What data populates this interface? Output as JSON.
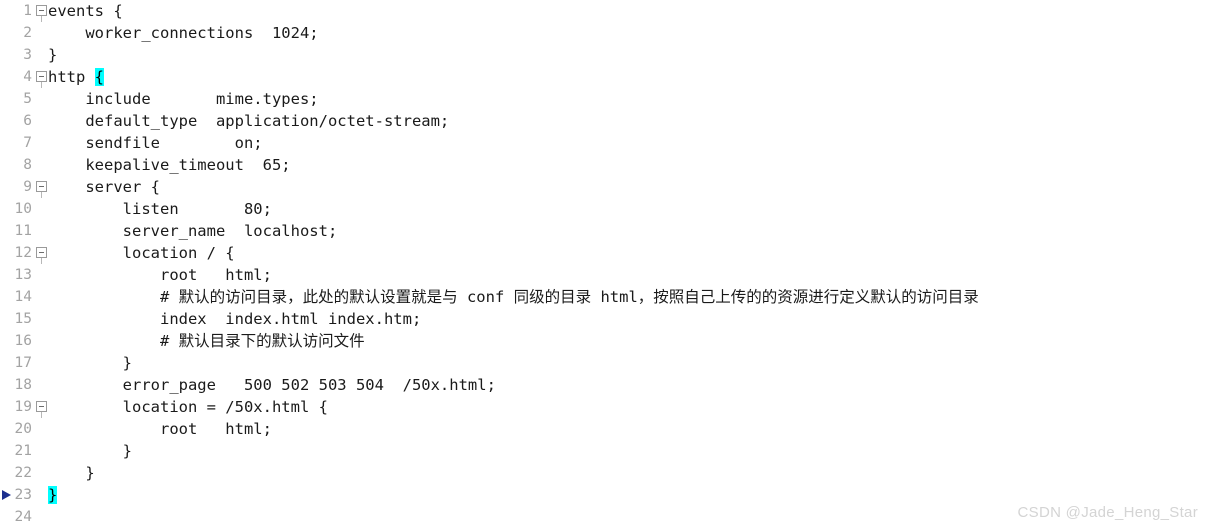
{
  "editor": {
    "language": "nginx-conf",
    "colors": {
      "background": "#ffffff",
      "text": "#1a1a1a",
      "line_number": "#a3a3a3",
      "brace_match_highlight": "#00ffff",
      "fold_marker": "#9a9a9a",
      "exec_marker": "#1b2f8f",
      "watermark": "#d4d4d4"
    },
    "lines": [
      {
        "n": "1",
        "fold": true,
        "marker": false,
        "text": "events {"
      },
      {
        "n": "2",
        "fold": false,
        "marker": false,
        "text": "    worker_connections  1024;"
      },
      {
        "n": "3",
        "fold": false,
        "marker": false,
        "text": "}"
      },
      {
        "n": "4",
        "fold": true,
        "marker": false,
        "pre": "http ",
        "hl": "{",
        "post": ""
      },
      {
        "n": "5",
        "fold": false,
        "marker": false,
        "text": "    include       mime.types;"
      },
      {
        "n": "6",
        "fold": false,
        "marker": false,
        "text": "    default_type  application/octet-stream;"
      },
      {
        "n": "7",
        "fold": false,
        "marker": false,
        "text": "    sendfile        on;"
      },
      {
        "n": "8",
        "fold": false,
        "marker": false,
        "text": "    keepalive_timeout  65;"
      },
      {
        "n": "9",
        "fold": true,
        "marker": false,
        "text": "    server {"
      },
      {
        "n": "10",
        "fold": false,
        "marker": false,
        "text": "        listen       80;"
      },
      {
        "n": "11",
        "fold": false,
        "marker": false,
        "text": "        server_name  localhost;"
      },
      {
        "n": "12",
        "fold": true,
        "marker": false,
        "text": "        location / {"
      },
      {
        "n": "13",
        "fold": false,
        "marker": false,
        "text": "            root   html;"
      },
      {
        "n": "14",
        "fold": false,
        "marker": false,
        "text": "            # 默认的访问目录，此处的默认设置就是与 conf 同级的目录 html，按照自己上传的的资源进行定义默认的访问目录"
      },
      {
        "n": "15",
        "fold": false,
        "marker": false,
        "text": "            index  index.html index.htm;"
      },
      {
        "n": "16",
        "fold": false,
        "marker": false,
        "text": "            # 默认目录下的默认访问文件"
      },
      {
        "n": "17",
        "fold": false,
        "marker": false,
        "text": "        }"
      },
      {
        "n": "18",
        "fold": false,
        "marker": false,
        "text": "        error_page   500 502 503 504  /50x.html;"
      },
      {
        "n": "19",
        "fold": true,
        "marker": false,
        "text": "        location = /50x.html {"
      },
      {
        "n": "20",
        "fold": false,
        "marker": false,
        "text": "            root   html;"
      },
      {
        "n": "21",
        "fold": false,
        "marker": false,
        "text": "        }"
      },
      {
        "n": "22",
        "fold": false,
        "marker": false,
        "text": "    }"
      },
      {
        "n": "23",
        "fold": false,
        "marker": true,
        "pre": "",
        "hl": "}",
        "post": ""
      },
      {
        "n": "24",
        "fold": false,
        "marker": false,
        "text": ""
      }
    ]
  },
  "watermark": {
    "text": "CSDN @Jade_Heng_Star"
  }
}
